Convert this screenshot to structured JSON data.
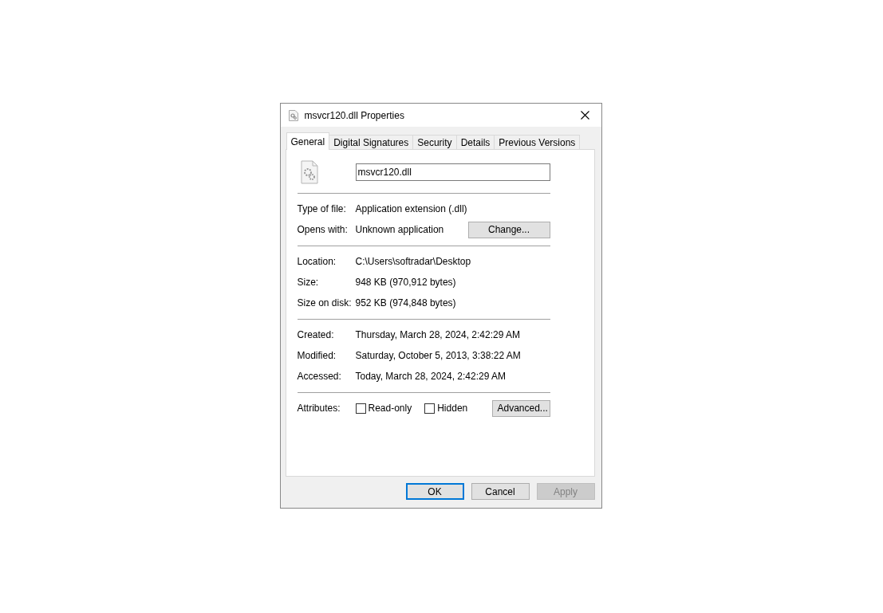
{
  "window": {
    "title": "msvcr120.dll Properties"
  },
  "tabs": [
    {
      "label": "General",
      "selected": true
    },
    {
      "label": "Digital Signatures",
      "selected": false
    },
    {
      "label": "Security",
      "selected": false
    },
    {
      "label": "Details",
      "selected": false
    },
    {
      "label": "Previous Versions",
      "selected": false
    }
  ],
  "file_name": {
    "value": "msvcr120.dll"
  },
  "sections": [
    {
      "rows": [
        {
          "label": "Type of file:",
          "value": "Application extension (.dll)"
        },
        {
          "label": "Opens with:",
          "value": "Unknown application",
          "button": "Change..."
        }
      ]
    },
    {
      "rows": [
        {
          "label": "Location:",
          "value": "C:\\Users\\softradar\\Desktop"
        },
        {
          "label": "Size:",
          "value": "948 KB (970,912 bytes)"
        },
        {
          "label": "Size on disk:",
          "value": "952 KB (974,848 bytes)"
        }
      ]
    },
    {
      "rows": [
        {
          "label": "Created:",
          "value": "Thursday, March 28, 2024, 2:42:29 AM"
        },
        {
          "label": "Modified:",
          "value": "Saturday, October 5, 2013, 3:38:22 AM"
        },
        {
          "label": "Accessed:",
          "value": "Today, March 28, 2024, 2:42:29 AM"
        }
      ]
    }
  ],
  "attributes": {
    "label": "Attributes:",
    "checkboxes": [
      {
        "label": "Read-only",
        "checked": false
      },
      {
        "label": "Hidden",
        "checked": false
      }
    ],
    "button": "Advanced..."
  },
  "buttons": [
    {
      "label": "OK",
      "default": true,
      "disabled": false
    },
    {
      "label": "Cancel",
      "default": false,
      "disabled": false
    },
    {
      "label": "Apply",
      "default": false,
      "disabled": true
    }
  ]
}
